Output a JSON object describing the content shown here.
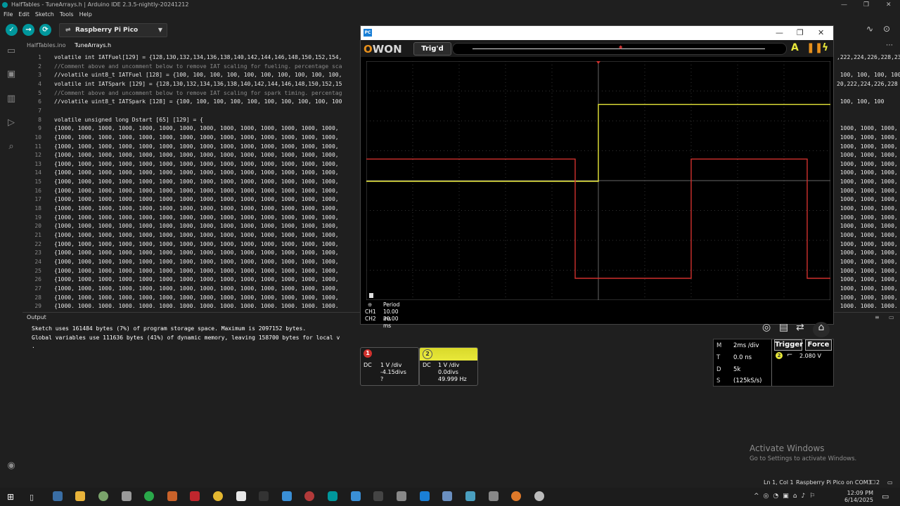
{
  "window": {
    "title": "HalfTables - TuneArrays.h | Arduino IDE 2.3.5-nightly-20241212",
    "controls": [
      "—",
      "❐",
      "✕"
    ]
  },
  "menu": [
    "File",
    "Edit",
    "Sketch",
    "Tools",
    "Help"
  ],
  "toolbar": {
    "board": "Raspberry Pi Pico",
    "buttons": [
      "verify",
      "upload",
      "debug"
    ]
  },
  "tabs": [
    {
      "label": "HalfTables.ino",
      "active": false
    },
    {
      "label": "TuneArrays.h",
      "active": true
    }
  ],
  "editor": {
    "lines": [
      {
        "n": "1",
        "text": "volatile int IATFuel[129] = {128,130,132,134,136,138,140,142,144,146,148,150,152,154,",
        "right": ",222,224,226,228,23",
        "cmt": false
      },
      {
        "n": "2",
        "text": "//Comment above and uncomment below to remove IAT scaling for fueling. percentage sca",
        "right": "",
        "cmt": true
      },
      {
        "n": "3",
        "text": "//volatile uint8_t IATFuel [128] = {100, 100, 100, 100, 100, 100, 100, 100, 100, 100,",
        "right": " 100, 100, 100, 100",
        "cmt": false
      },
      {
        "n": "4",
        "text": "volatile int IATSpark [129] = {128,130,132,134,136,138,140,142,144,146,148,150,152,15",
        "right": "20,222,224,226,228",
        "cmt": false
      },
      {
        "n": "5",
        "text": "//Comment above and uncomment below to remove IAT scaling for spark timing. percentag",
        "right": "",
        "cmt": true
      },
      {
        "n": "6",
        "text": "//volatile uint8_t IATSpark [128] = {100, 100, 100, 100, 100, 100, 100, 100, 100, 100",
        "right": " 100, 100, 100",
        "cmt": false
      },
      {
        "n": "7",
        "text": "",
        "right": "",
        "cmt": false
      },
      {
        "n": "8",
        "text": "volatile unsigned long Dstart [65] [129] = {",
        "right": "",
        "cmt": false
      },
      {
        "n": "9",
        "text": "{1000, 1000, 1000, 1000, 1000, 1000, 1000, 1000, 1000, 1000, 1000, 1000, 1000, 1000,",
        "right": " 1000, 1000, 1000,",
        "cmt": false
      },
      {
        "n": "10",
        "text": "{1000, 1000, 1000, 1000, 1000, 1000, 1000, 1000, 1000, 1000, 1000, 1000, 1000, 1000,",
        "right": " 1000, 1000, 1000,",
        "cmt": false
      },
      {
        "n": "11",
        "text": "{1000, 1000, 1000, 1000, 1000, 1000, 1000, 1000, 1000, 1000, 1000, 1000, 1000, 1000,",
        "right": " 1000, 1000, 1000,",
        "cmt": false
      },
      {
        "n": "12",
        "text": "{1000, 1000, 1000, 1000, 1000, 1000, 1000, 1000, 1000, 1000, 1000, 1000, 1000, 1000,",
        "right": " 1000, 1000, 1000,",
        "cmt": false
      },
      {
        "n": "13",
        "text": "{1000, 1000, 1000, 1000, 1000, 1000, 1000, 1000, 1000, 1000, 1000, 1000, 1000, 1000,",
        "right": " 1000, 1000, 1000,",
        "cmt": false
      },
      {
        "n": "14",
        "text": "{1000, 1000, 1000, 1000, 1000, 1000, 1000, 1000, 1000, 1000, 1000, 1000, 1000, 1000,",
        "right": " 1000, 1000, 1000,",
        "cmt": false
      },
      {
        "n": "15",
        "text": "{1000, 1000, 1000, 1000, 1000, 1000, 1000, 1000, 1000, 1000, 1000, 1000, 1000, 1000,",
        "right": " 1000, 1000, 1000,",
        "cmt": false
      },
      {
        "n": "16",
        "text": "{1000, 1000, 1000, 1000, 1000, 1000, 1000, 1000, 1000, 1000, 1000, 1000, 1000, 1000,",
        "right": " 1000, 1000, 1000,",
        "cmt": false
      },
      {
        "n": "17",
        "text": "{1000, 1000, 1000, 1000, 1000, 1000, 1000, 1000, 1000, 1000, 1000, 1000, 1000, 1000,",
        "right": " 1000, 1000, 1000,",
        "cmt": false
      },
      {
        "n": "18",
        "text": "{1000, 1000, 1000, 1000, 1000, 1000, 1000, 1000, 1000, 1000, 1000, 1000, 1000, 1000,",
        "right": " 1000, 1000, 1000,",
        "cmt": false
      },
      {
        "n": "19",
        "text": "{1000, 1000, 1000, 1000, 1000, 1000, 1000, 1000, 1000, 1000, 1000, 1000, 1000, 1000,",
        "right": " 1000, 1000, 1000,",
        "cmt": false
      },
      {
        "n": "20",
        "text": "{1000, 1000, 1000, 1000, 1000, 1000, 1000, 1000, 1000, 1000, 1000, 1000, 1000, 1000,",
        "right": " 1000, 1000, 1000,",
        "cmt": false
      },
      {
        "n": "21",
        "text": "{1000, 1000, 1000, 1000, 1000, 1000, 1000, 1000, 1000, 1000, 1000, 1000, 1000, 1000,",
        "right": " 1000, 1000, 1000,",
        "cmt": false
      },
      {
        "n": "22",
        "text": "{1000, 1000, 1000, 1000, 1000, 1000, 1000, 1000, 1000, 1000, 1000, 1000, 1000, 1000,",
        "right": " 1000, 1000, 1000,",
        "cmt": false
      },
      {
        "n": "23",
        "text": "{1000, 1000, 1000, 1000, 1000, 1000, 1000, 1000, 1000, 1000, 1000, 1000, 1000, 1000,",
        "right": " 1000, 1000, 1000,",
        "cmt": false
      },
      {
        "n": "24",
        "text": "{1000, 1000, 1000, 1000, 1000, 1000, 1000, 1000, 1000, 1000, 1000, 1000, 1000, 1000,",
        "right": " 1000, 1000, 1000,",
        "cmt": false
      },
      {
        "n": "25",
        "text": "{1000, 1000, 1000, 1000, 1000, 1000, 1000, 1000, 1000, 1000, 1000, 1000, 1000, 1000,",
        "right": " 1000, 1000, 1000,",
        "cmt": false
      },
      {
        "n": "26",
        "text": "{1000, 1000, 1000, 1000, 1000, 1000, 1000, 1000, 1000, 1000, 1000, 1000, 1000, 1000,",
        "right": " 1000, 1000, 1000,",
        "cmt": false
      },
      {
        "n": "27",
        "text": "{1000, 1000, 1000, 1000, 1000, 1000, 1000, 1000, 1000, 1000, 1000, 1000, 1000, 1000,",
        "right": " 1000, 1000, 1000,",
        "cmt": false
      },
      {
        "n": "28",
        "text": "{1000, 1000, 1000, 1000, 1000, 1000, 1000, 1000, 1000, 1000, 1000, 1000, 1000, 1000,",
        "right": " 1000, 1000, 1000,",
        "cmt": false
      },
      {
        "n": "29",
        "text": "{1000. 1000. 1000. 1000. 1000. 1000. 1000. 1000. 1000. 1000. 1000. 1000. 1000. 1000.",
        "right": " 1000. 1000. 1000.",
        "cmt": false
      }
    ]
  },
  "output": {
    "header": "Output",
    "lines": [
      "Sketch uses 161484 bytes (7%) of program storage space. Maximum is 2097152 bytes.",
      "Global variables use 111636 bytes (41%) of dynamic memory, leaving 158700 bytes for local v",
      "."
    ]
  },
  "activate": {
    "title": "Activate Windows",
    "sub": "Go to Settings to activate Windows."
  },
  "statusbar": {
    "position": "Ln 1, Col 1",
    "board": "Raspberry Pi Pico on COM3",
    "count": "2"
  },
  "taskbar": {
    "time": "12:09 PM",
    "date": "6/14/2025"
  },
  "scope": {
    "app_icon": "PC",
    "brand_o": "O",
    "brand_rest": "WON",
    "trig_status": "Trig'd",
    "auto_label": "A",
    "meas_title": "Period",
    "meas": [
      {
        "ch": "CH1",
        "value": "10.00 ms"
      },
      {
        "ch": "CH2",
        "value": "20.00 ms"
      }
    ],
    "ch1": {
      "coupling": "DC",
      "vdiv": "1 V /div",
      "offset": "-4.15divs",
      "freq": "?",
      "color": "#d0312d"
    },
    "ch2": {
      "coupling": "DC",
      "vdiv": "1 V /div",
      "offset": "0.0divs",
      "freq": "49.999 Hz",
      "color": "#e8e83a"
    },
    "ch1_label": "1",
    "ch2_label": "2",
    "timebase": [
      {
        "k": "M",
        "v": "2ms /div"
      },
      {
        "k": "T",
        "v": "0.0 ns"
      },
      {
        "k": "D",
        "v": "5k"
      },
      {
        "k": "S",
        "v": "(125kS/s)"
      }
    ],
    "trigger_label": "Trigger",
    "force_label": "Force",
    "trigger_level": "2.080 V",
    "trigger_channel": "2",
    "waveforms": {
      "ch2_yellow": {
        "period_ms": 20,
        "duty": 0.5,
        "high_v": 3.3,
        "low_v": 0,
        "color": "#e8e83a"
      },
      "ch1_red": {
        "period_ms": 10,
        "duty": 0.5,
        "high_v": 3.3,
        "low_v": 0,
        "color": "#d0312d"
      }
    }
  }
}
